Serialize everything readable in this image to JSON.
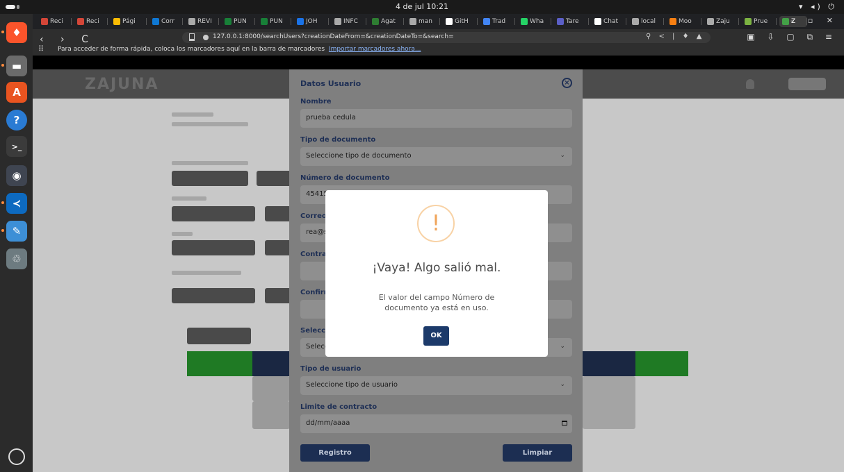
{
  "system": {
    "clock": "4 de jul  10:21"
  },
  "browser": {
    "tabs": [
      {
        "label": "Reci",
        "color": "#d44638"
      },
      {
        "label": "Reci",
        "color": "#d44638"
      },
      {
        "label": "Pági",
        "color": "#fbbc04"
      },
      {
        "label": "Corr",
        "color": "#0f78d4"
      },
      {
        "label": "REVI",
        "color": "#aaaaaa"
      },
      {
        "label": "PUN",
        "color": "#188038"
      },
      {
        "label": "PUN",
        "color": "#188038"
      },
      {
        "label": "JOH",
        "color": "#1a73e8"
      },
      {
        "label": "INFC",
        "color": "#aaaaaa"
      },
      {
        "label": "Agat",
        "color": "#2e7d32"
      },
      {
        "label": "man",
        "color": "#aaaaaa"
      },
      {
        "label": "GitH",
        "color": "#ffffff"
      },
      {
        "label": "Trad",
        "color": "#4285f4"
      },
      {
        "label": "Wha",
        "color": "#25d366"
      },
      {
        "label": "Tare",
        "color": "#5b5fc7"
      },
      {
        "label": "Chat",
        "color": "#ffffff"
      },
      {
        "label": "local",
        "color": "#aaaaaa"
      },
      {
        "label": "Moo",
        "color": "#f98012"
      },
      {
        "label": "Zaju",
        "color": "#aaaaaa"
      },
      {
        "label": "Prue",
        "color": "#7cb342"
      },
      {
        "label": "Z",
        "color": "#43a047"
      }
    ],
    "url": "127.0.0.1:8000/searchUsers?creationDateFrom=&creationDateTo=&search=",
    "bookmarks_message": "Para acceder de forma rápida, coloca los marcadores aquí en la barra de marcadores",
    "bookmarks_link": "Importar marcadores ahora..."
  },
  "page": {
    "logo": "ZAJUNA"
  },
  "form_modal": {
    "title": "Datos Usuario",
    "fields": [
      {
        "label": "Nombre",
        "value": "prueba cedula"
      },
      {
        "label": "Tipo de documento",
        "value": "Seleccione tipo de documento"
      },
      {
        "label": "Número de documento",
        "value": "45415"
      },
      {
        "label": "Correo",
        "value": "rea@s"
      },
      {
        "label": "Contras",
        "value": ""
      },
      {
        "label": "Confirm",
        "value": ""
      },
      {
        "label": "Selecci",
        "value": "Selecc"
      },
      {
        "label": "Tipo de usuario",
        "value": "Seleccione tipo de usuario"
      },
      {
        "label": "Limite de contracto",
        "value": "dd/mm/aaaa"
      }
    ],
    "register_button": "Registro",
    "clear_button": "Limpiar"
  },
  "alert": {
    "icon": "!",
    "title": "¡Vaya! Algo salió mal.",
    "message": "El valor del campo Número de documento ya está en uso.",
    "ok_button": "OK"
  },
  "colors": {
    "accent": "#1c2e52",
    "warning": "#f0a45a",
    "table_head_dark": "#1a2742",
    "table_head_green": "#1f7a24"
  }
}
